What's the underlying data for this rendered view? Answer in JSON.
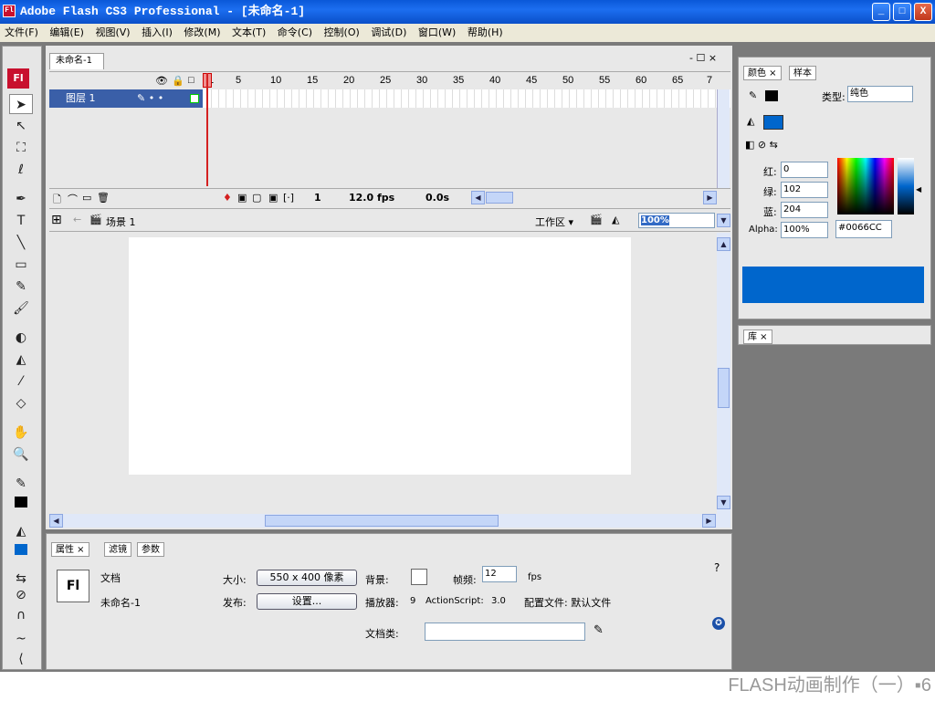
{
  "window": {
    "title": "Adobe Flash CS3 Professional - [未命名-1]",
    "app_icon": "Fl",
    "min": "_",
    "max": "□",
    "close": "X"
  },
  "menu": [
    "文件(F)",
    "编辑(E)",
    "视图(V)",
    "插入(I)",
    "修改(M)",
    "文本(T)",
    "命令(C)",
    "控制(O)",
    "调试(D)",
    "窗口(W)",
    "帮助(H)"
  ],
  "toolbox": {
    "logo": "Fl"
  },
  "document": {
    "tab": "未命名-1",
    "controls": "- ☐ ×",
    "timeline": {
      "frame_numbers": [
        "1",
        "5",
        "10",
        "15",
        "20",
        "25",
        "30",
        "35",
        "40",
        "45",
        "50",
        "55",
        "60",
        "65",
        "7"
      ],
      "layer_name": "图层 1",
      "current_frame": "1",
      "fps": "12.0 fps",
      "time": "0.0s"
    },
    "edit_bar": {
      "scene": "场景 1",
      "workspace": "工作区 ▾",
      "zoom": "100%"
    }
  },
  "properties": {
    "tabs": [
      "属性 ×",
      "滤镜",
      "参数"
    ],
    "doc_label": "文档",
    "doc_name": "未命名-1",
    "size_label": "大小:",
    "size_value": "550 x 400 像素",
    "background_label": "背景:",
    "framerate_label": "帧频:",
    "framerate_value": "12",
    "fps_unit": "fps",
    "publish_label": "发布:",
    "settings_button": "设置...",
    "player_label": "播放器:",
    "player_value": "9",
    "actionscript_label": "ActionScript:",
    "actionscript_value": "3.0",
    "profile_label": "配置文件: 默认文件",
    "docclass_label": "文档类:",
    "help": "?"
  },
  "color_panel": {
    "tabs": [
      "颜色 ×",
      "样本"
    ],
    "type_label": "类型:",
    "type_value": "纯色",
    "red_label": "红:",
    "red_value": "0",
    "green_label": "绿:",
    "green_value": "102",
    "blue_label": "蓝:",
    "blue_value": "204",
    "alpha_label": "Alpha:",
    "alpha_value": "100%",
    "hex_value": "#0066CC",
    "color": "#0066cc"
  },
  "library_panel": {
    "tab": "库 ×"
  },
  "caption": "FLASH动画制作（一）▪6"
}
